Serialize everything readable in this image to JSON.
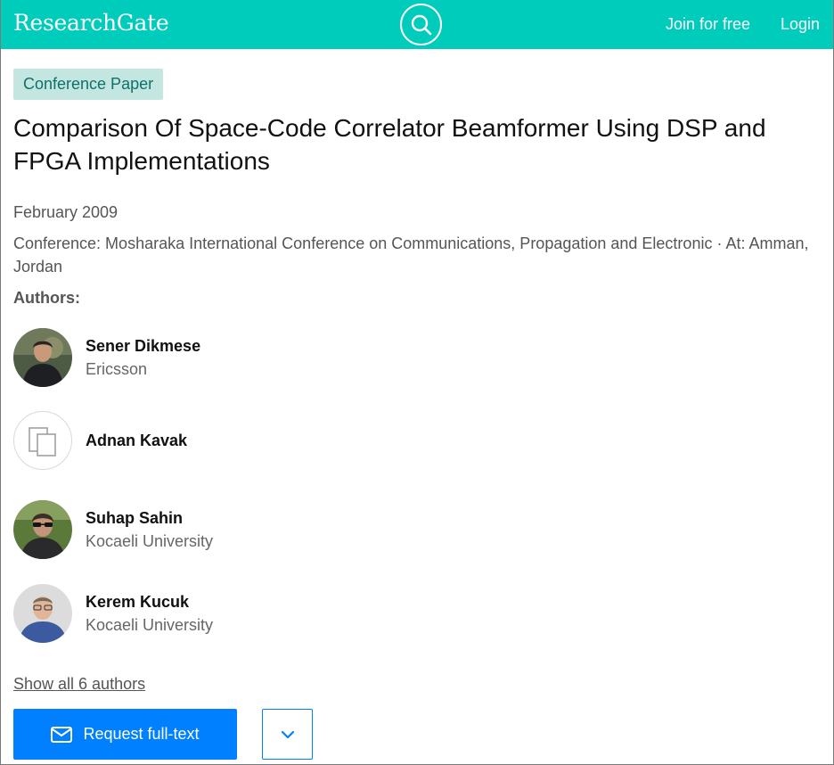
{
  "header": {
    "logo": "ResearchGate",
    "join_label": "Join for free",
    "login_label": "Login",
    "brand_color": "#00ccbb"
  },
  "publication": {
    "type_badge": "Conference Paper",
    "title": "Comparison Of Space-Code Correlator Beamformer Using DSP and FPGA Implementations",
    "date": "February 2009",
    "conference": "Conference: Mosharaka International Conference on Communications, Propagation and Electronic · At: Amman, Jordan"
  },
  "authors_label": "Authors:",
  "authors": [
    {
      "name": "Sener Dikmese",
      "institution": "Ericsson",
      "avatar": "photo"
    },
    {
      "name": "Adnan Kavak",
      "institution": "",
      "avatar": "placeholder-icon"
    },
    {
      "name": "Suhap Sahin",
      "institution": "Kocaeli University",
      "avatar": "photo"
    },
    {
      "name": "Kerem Kucuk",
      "institution": "Kocaeli University",
      "avatar": "photo"
    }
  ],
  "show_all_label": "Show all 6 authors",
  "actions": {
    "request_label": "Request full-text",
    "accent_color": "#0080ff"
  }
}
